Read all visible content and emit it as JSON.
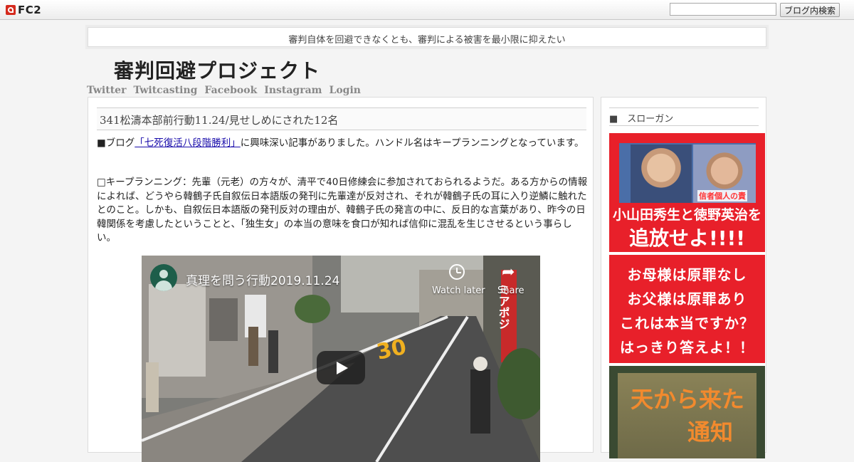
{
  "fc2_bar": {
    "logo_text": "FC2",
    "search_placeholder": "",
    "search_button_label": "ブログ内検索"
  },
  "header": {
    "tagline": "審判自体を回避できなくとも、審判による被害を最小限に抑えたい",
    "blog_title": "審判回避プロジェクト",
    "nav_links": [
      {
        "label": "Twitter"
      },
      {
        "label": "Twitcasting"
      },
      {
        "label": "Facebook"
      },
      {
        "label": "Instagram"
      },
      {
        "label": "Login"
      }
    ]
  },
  "entry": {
    "title": "341松濤本部前行動11.24/見せしめにされた12名",
    "para1_prefix": "■ブログ",
    "para1_link": "「七死復活八段階勝利」",
    "para1_suffix": "に興味深い記事がありました。ハンドル名はキープランニングとなっています。",
    "para2": "□キープランニング：先輩（元老）の方々が、清平で40日修練会に参加されておられるようだ。ある方からの情報によれば、どうやら韓鶴子氏自叙伝日本語版の発刊に先輩達が反対され、それが韓鶴子氏の耳に入り逆鱗に触れたとのこと。しかも、自叙伝日本語版の発刊反対の理由が、韓鶴子氏の発言の中に、反日的な言葉があり、昨今の日韓関係を考慮したということと、「独生女」の本当の意味を食口が知れば信仰に混乱を生じさせるという事らしい。"
  },
  "video": {
    "title": "真理を問う行動2019.11.24",
    "watch_later_label": "Watch later",
    "share_label": "Share",
    "road_marking": "30",
    "banner_text": "ミアポジ"
  },
  "sidebar": {
    "heading": "■　スローガン",
    "banner1": {
      "caption": "信者個人の責",
      "line1": "小山田秀生と徳野英治を",
      "line2": "追放せよ!!!!"
    },
    "banner2": {
      "lines": [
        "お母様は原罪なし",
        "お父様は原罪あり",
        "これは本当ですか？",
        "はっきり答えよ！！"
      ]
    },
    "banner3": {
      "line1": "天から来た",
      "line2": "通知"
    }
  }
}
